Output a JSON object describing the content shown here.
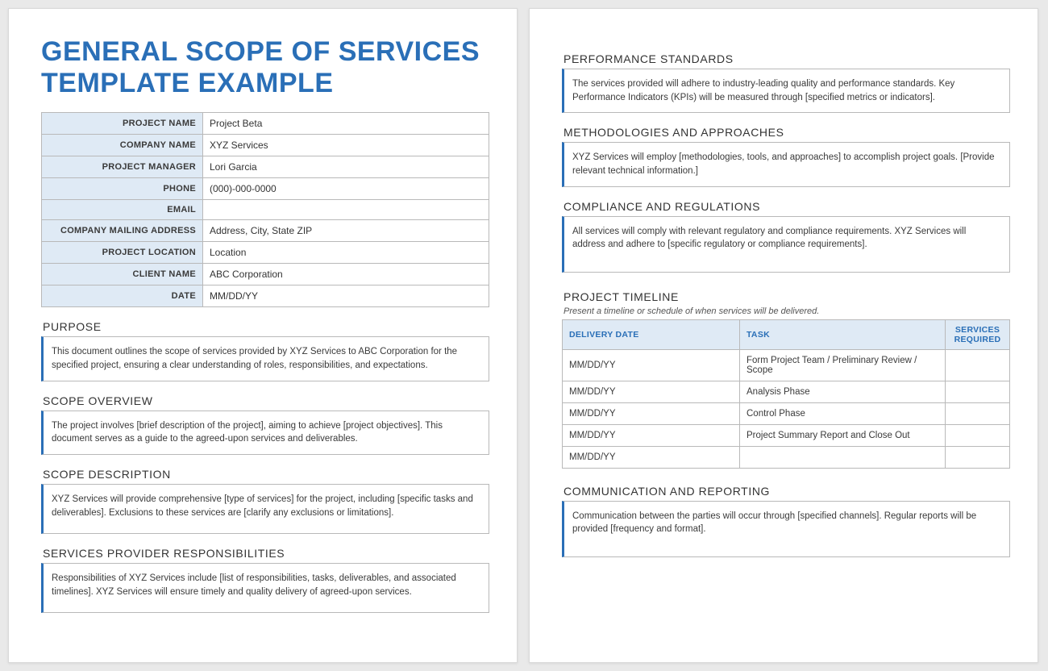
{
  "title": "GENERAL SCOPE OF SERVICES TEMPLATE EXAMPLE",
  "info": {
    "project_name": {
      "label": "PROJECT NAME",
      "value": "Project Beta"
    },
    "company_name": {
      "label": "COMPANY NAME",
      "value": "XYZ Services"
    },
    "project_manager": {
      "label": "PROJECT MANAGER",
      "value": "Lori Garcia"
    },
    "phone": {
      "label": "PHONE",
      "value": "(000)-000-0000"
    },
    "email": {
      "label": "EMAIL",
      "value": ""
    },
    "mailing": {
      "label": "COMPANY MAILING ADDRESS",
      "value": "Address, City, State ZIP"
    },
    "location": {
      "label": "PROJECT LOCATION",
      "value": "Location"
    },
    "client": {
      "label": "CLIENT NAME",
      "value": "ABC Corporation"
    },
    "date": {
      "label": "DATE",
      "value": "MM/DD/YY"
    }
  },
  "sections": {
    "purpose": {
      "heading": "PURPOSE",
      "body": "This document outlines the scope of services provided by XYZ Services to ABC Corporation for the specified project, ensuring a clear understanding of roles, responsibilities, and expectations."
    },
    "overview": {
      "heading": "SCOPE OVERVIEW",
      "body": "The project involves [brief description of the project], aiming to achieve [project objectives]. This document serves as a guide to the agreed-upon services and deliverables."
    },
    "description": {
      "heading": "SCOPE DESCRIPTION",
      "body": "XYZ Services will provide comprehensive [type of services] for the project, including [specific tasks and deliverables]. Exclusions to these services are [clarify any exclusions or limitations]."
    },
    "responsibilities": {
      "heading": "SERVICES PROVIDER RESPONSIBILITIES",
      "body": "Responsibilities of XYZ Services include [list of responsibilities, tasks, deliverables, and associated timelines]. XYZ Services will ensure timely and quality delivery of agreed-upon services."
    },
    "performance": {
      "heading": "PERFORMANCE STANDARDS",
      "body": "The services provided will adhere to industry-leading quality and performance standards. Key Performance Indicators (KPIs) will be measured through [specified metrics or indicators]."
    },
    "methodologies": {
      "heading": "METHODOLOGIES AND APPROACHES",
      "body": "XYZ Services will employ [methodologies, tools, and approaches] to accomplish project goals. [Provide relevant technical information.]"
    },
    "compliance": {
      "heading": "COMPLIANCE AND REGULATIONS",
      "body": "All services will comply with relevant regulatory and compliance requirements. XYZ Services will address and adhere to [specific regulatory or compliance requirements]."
    },
    "timeline": {
      "heading": "PROJECT TIMELINE",
      "subheading": "Present a timeline or schedule of when services will be delivered.",
      "columns": {
        "date": "DELIVERY DATE",
        "task": "TASK",
        "req": "SERVICES REQUIRED"
      },
      "rows": [
        {
          "date": "MM/DD/YY",
          "task": "Form Project Team / Preliminary Review / Scope",
          "req": ""
        },
        {
          "date": "MM/DD/YY",
          "task": "Analysis Phase",
          "req": ""
        },
        {
          "date": "MM/DD/YY",
          "task": "Control Phase",
          "req": ""
        },
        {
          "date": "MM/DD/YY",
          "task": "Project Summary Report and Close Out",
          "req": ""
        },
        {
          "date": "MM/DD/YY",
          "task": "",
          "req": ""
        }
      ]
    },
    "communication": {
      "heading": "COMMUNICATION AND REPORTING",
      "body": "Communication between the parties will occur through [specified channels]. Regular reports will be provided [frequency and format]."
    }
  }
}
